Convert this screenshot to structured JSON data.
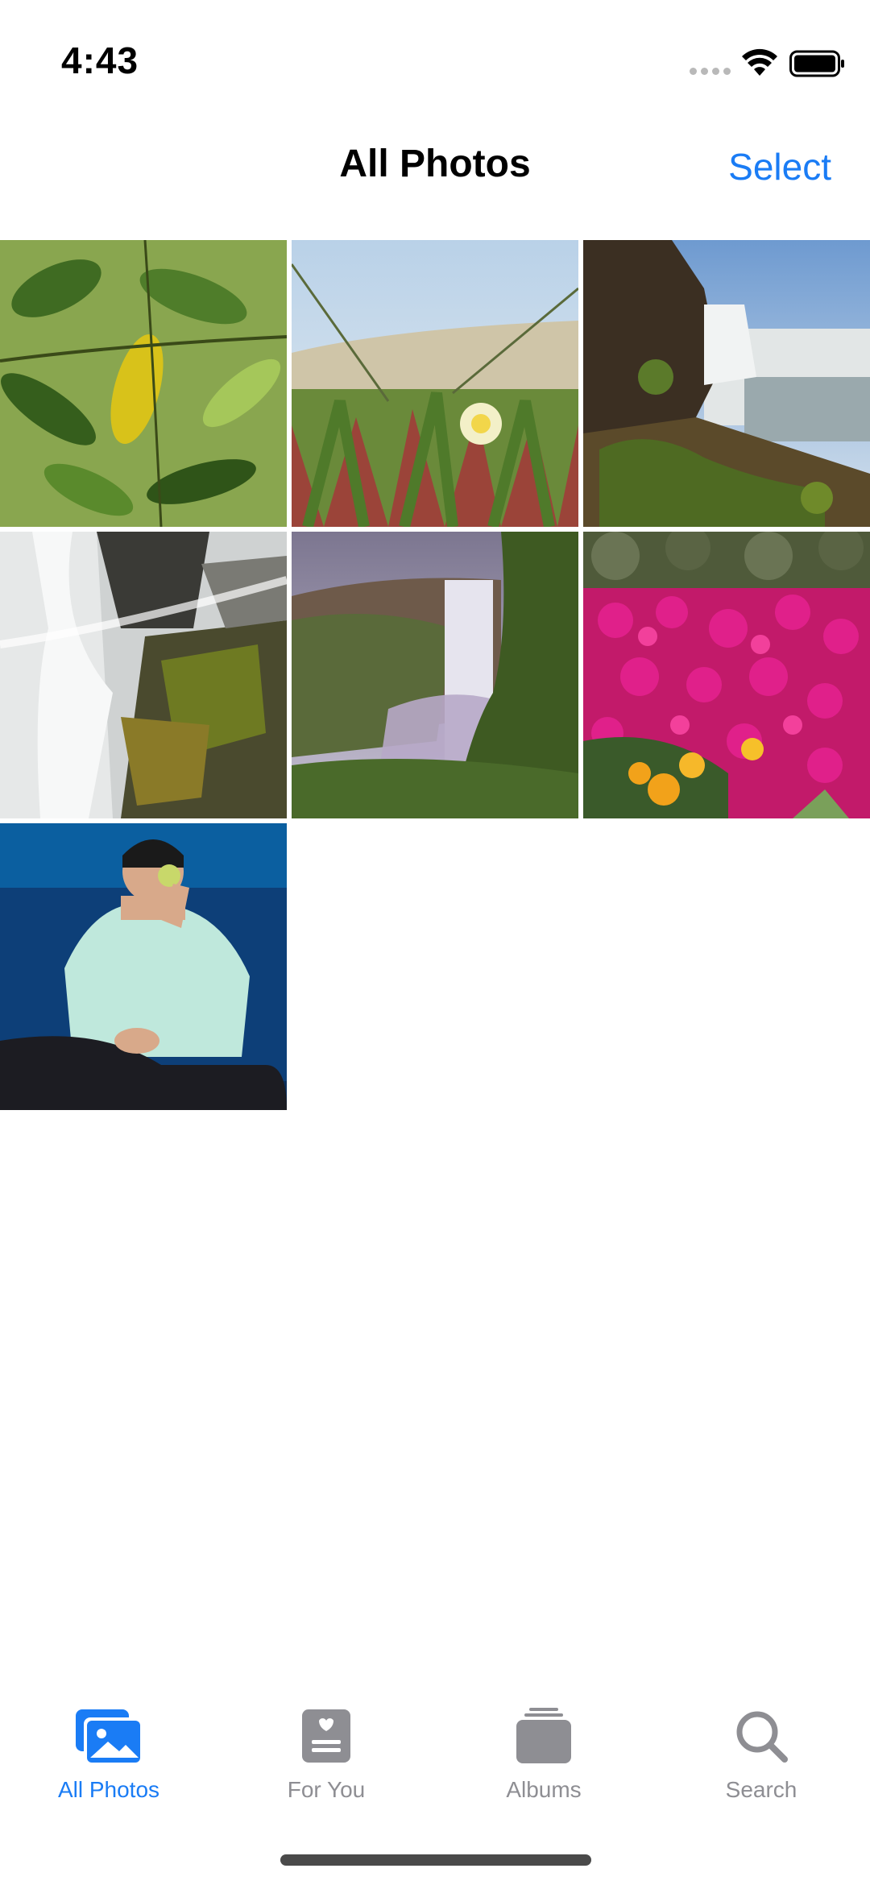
{
  "status_bar": {
    "time": "4:43"
  },
  "nav": {
    "title": "All Photos",
    "select_label": "Select"
  },
  "photos": [
    {
      "subject": "green-leaves"
    },
    {
      "subject": "white-flower-succulents"
    },
    {
      "subject": "waterfall-cliff"
    },
    {
      "subject": "waterfall-mossy-rocks"
    },
    {
      "subject": "waterfall-canyon"
    },
    {
      "subject": "pink-flowers-field"
    },
    {
      "subject": "man-with-apple"
    }
  ],
  "tab_bar": {
    "tabs": [
      {
        "label": "All Photos",
        "icon": "photos-icon",
        "active": true
      },
      {
        "label": "For You",
        "icon": "for-you-icon",
        "active": false
      },
      {
        "label": "Albums",
        "icon": "albums-icon",
        "active": false
      },
      {
        "label": "Search",
        "icon": "search-icon",
        "active": false
      }
    ]
  },
  "colors": {
    "accent": "#1a7cf5",
    "inactive": "#8e8e93"
  }
}
